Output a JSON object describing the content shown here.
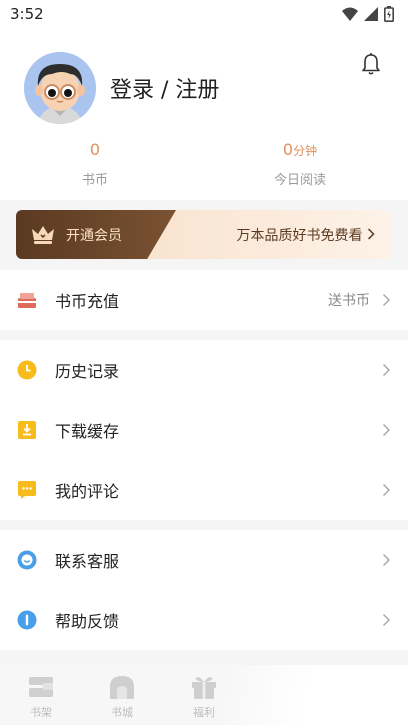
{
  "status_bar": {
    "time": "3:52"
  },
  "profile": {
    "login_text": "登录 / 注册",
    "coins": {
      "value": "0",
      "label": "书币"
    },
    "reading": {
      "value": "0",
      "unit": "分钟",
      "label": "今日阅读"
    }
  },
  "vip_banner": {
    "open_label": "开通会员",
    "promo_text": "万本品质好书免费看"
  },
  "menu": {
    "recharge": {
      "label": "书币充值",
      "extra": "送书币",
      "icon": "recharge-icon"
    },
    "history": {
      "label": "历史记录",
      "icon": "clock-icon"
    },
    "download": {
      "label": "下载缓存",
      "icon": "download-icon"
    },
    "comments": {
      "label": "我的评论",
      "icon": "comment-icon"
    },
    "service": {
      "label": "联系客服",
      "icon": "customer-service-icon"
    },
    "feedback": {
      "label": "帮助反馈",
      "icon": "info-icon"
    }
  },
  "tab_bar": {
    "shelf": "书架",
    "store": "书城",
    "welfare": "福利"
  },
  "colors": {
    "accent_orange": "#e0915a",
    "vip_dark": "#5a3a22",
    "recharge_red": "#e06a5a",
    "history_yellow": "#f8bb1c",
    "service_blue": "#4aa0e8"
  }
}
